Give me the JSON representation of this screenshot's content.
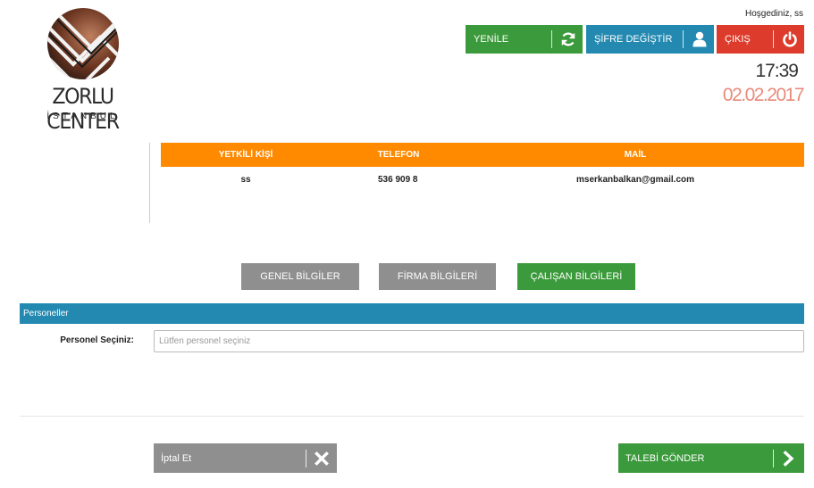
{
  "brand": {
    "name": "ZORLU CENTER",
    "city": "İSTANBUL"
  },
  "header": {
    "welcome": "Hoşgediniz, ss",
    "refresh_label": "YENİLE",
    "change_password_label": "ŞİFRE DEĞİŞTİR",
    "logout_label": "ÇIKIŞ",
    "time": "17:39",
    "date": "02.02.2017"
  },
  "contact_table": {
    "headers": [
      "YETKİLİ KİŞİ",
      "TELEFON",
      "MAİL"
    ],
    "row": [
      "ss",
      "536 909 8",
      "mserkanbalkan@gmail.com"
    ]
  },
  "tabs": {
    "general": "GENEL BİLGİLER",
    "company": "FİRMA BİLGİLERİ",
    "employee": "ÇALIŞAN BİLGİLERİ",
    "active": "employee"
  },
  "panel": {
    "title": "Personeller",
    "select_label": "Personel Seçiniz:",
    "select_placeholder": "Lütfen personel seçiniz",
    "select_value": ""
  },
  "actions": {
    "cancel_label": "İptal Et",
    "submit_label": "TALEBİ GÖNDER"
  },
  "colors": {
    "green": "#3b9a3b",
    "blue": "#2389b1",
    "red": "#dd3b2b",
    "orange": "#ff8a00",
    "gray": "#8f8f8f"
  }
}
